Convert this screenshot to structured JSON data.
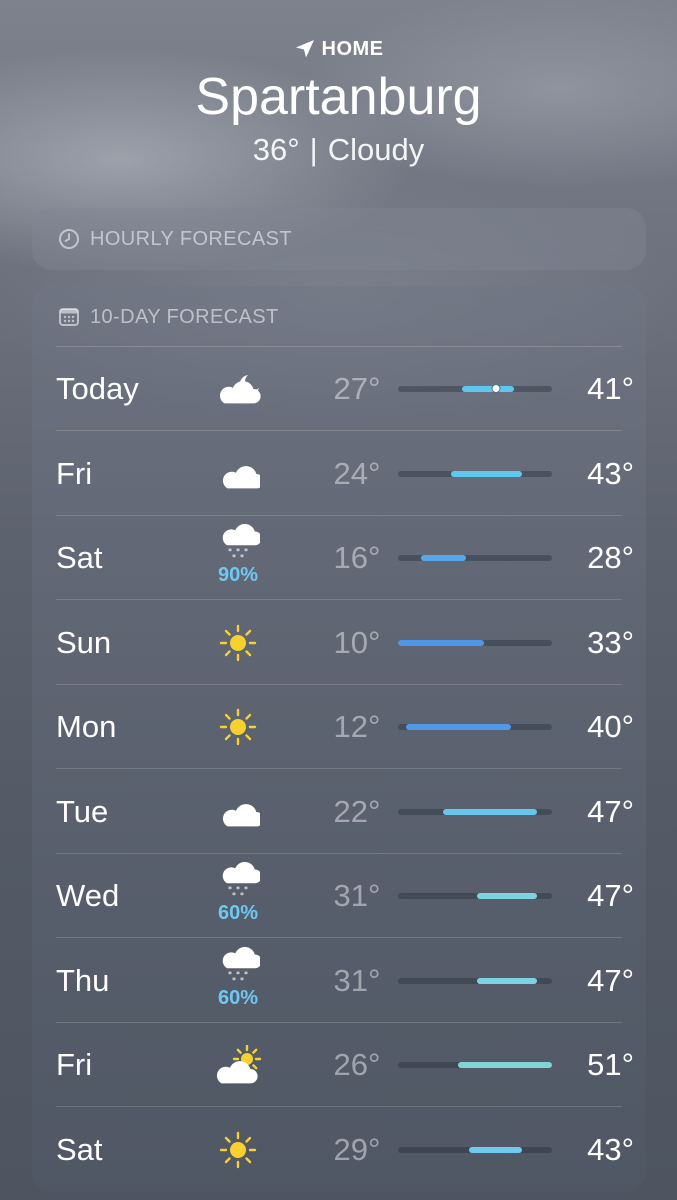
{
  "header": {
    "home_label": "HOME",
    "city": "Spartanburg",
    "current_temp": "36°",
    "separator": "|",
    "condition": "Cloudy"
  },
  "hourly": {
    "title": "HOURLY FORECAST"
  },
  "tenday": {
    "title": "10-DAY FORECAST",
    "range_min": 10,
    "range_max": 51,
    "days": [
      {
        "day": "Today",
        "icon": "cloud-moon-icon",
        "precip": "",
        "lo": "27°",
        "hi": "41°",
        "lo_val": 27,
        "hi_val": 41,
        "current_val": 36,
        "color": "#5ec7f0"
      },
      {
        "day": "Fri",
        "icon": "cloud-icon",
        "precip": "",
        "lo": "24°",
        "hi": "43°",
        "lo_val": 24,
        "hi_val": 43,
        "color": "#5ec8ee"
      },
      {
        "day": "Sat",
        "icon": "cloud-snow-icon",
        "precip": "90%",
        "lo": "16°",
        "hi": "28°",
        "lo_val": 16,
        "hi_val": 28,
        "color": "#56a8ea"
      },
      {
        "day": "Sun",
        "icon": "sun-icon",
        "precip": "",
        "lo": "10°",
        "hi": "33°",
        "lo_val": 10,
        "hi_val": 33,
        "color": "#4f97e6"
      },
      {
        "day": "Mon",
        "icon": "sun-icon",
        "precip": "",
        "lo": "12°",
        "hi": "40°",
        "lo_val": 12,
        "hi_val": 40,
        "color": "#4e9ae8"
      },
      {
        "day": "Tue",
        "icon": "cloud-icon",
        "precip": "",
        "lo": "22°",
        "hi": "47°",
        "lo_val": 22,
        "hi_val": 47,
        "color": "#66c6ec"
      },
      {
        "day": "Wed",
        "icon": "cloud-snow-icon",
        "precip": "60%",
        "lo": "31°",
        "hi": "47°",
        "lo_val": 31,
        "hi_val": 47,
        "color": "#7dd3e0"
      },
      {
        "day": "Thu",
        "icon": "cloud-snow-icon",
        "precip": "60%",
        "lo": "31°",
        "hi": "47°",
        "lo_val": 31,
        "hi_val": 47,
        "color": "#7dd3e0"
      },
      {
        "day": "Fri",
        "icon": "cloud-sun-icon",
        "precip": "",
        "lo": "26°",
        "hi": "51°",
        "lo_val": 26,
        "hi_val": 51,
        "color": "#7ed5d6"
      },
      {
        "day": "Sat",
        "icon": "sun-icon",
        "precip": "",
        "lo": "29°",
        "hi": "43°",
        "lo_val": 29,
        "hi_val": 43,
        "color": "#6ccbee"
      }
    ]
  }
}
